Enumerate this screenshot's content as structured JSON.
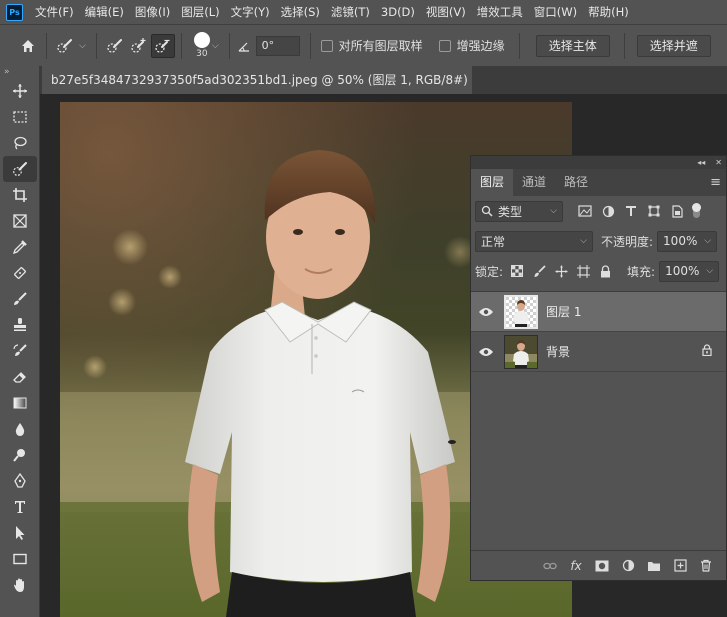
{
  "app": {
    "logo": "Ps"
  },
  "menu": [
    "文件(F)",
    "编辑(E)",
    "图像(I)",
    "图层(L)",
    "文字(Y)",
    "选择(S)",
    "滤镜(T)",
    "3D(D)",
    "视图(V)",
    "增效工具",
    "窗口(W)",
    "帮助(H)"
  ],
  "options": {
    "brush_size": "30",
    "angle": "0°",
    "sample_all_layers": "对所有图层取样",
    "enhance_edge": "增强边缘",
    "select_subject": "选择主体",
    "select_and_mask": "选择并遮"
  },
  "document": {
    "tab_title": "b27e5f3484732937350f5ad302351bd1.jpeg @ 50% (图层 1, RGB/8#) *"
  },
  "layers_panel": {
    "tabs": [
      "图层",
      "通道",
      "路径"
    ],
    "filter_kind": "类型",
    "blend_mode": "正常",
    "opacity_label": "不透明度:",
    "opacity_value": "100%",
    "lock_label": "锁定:",
    "fill_label": "填充:",
    "fill_value": "100%",
    "layers": [
      {
        "name": "图层 1",
        "selected": true,
        "locked": false
      },
      {
        "name": "背景",
        "selected": false,
        "locked": true
      }
    ]
  },
  "colors": {
    "ui_dark": "#535353",
    "canvas_bg": "#282828",
    "accent": "#31a8ff"
  }
}
